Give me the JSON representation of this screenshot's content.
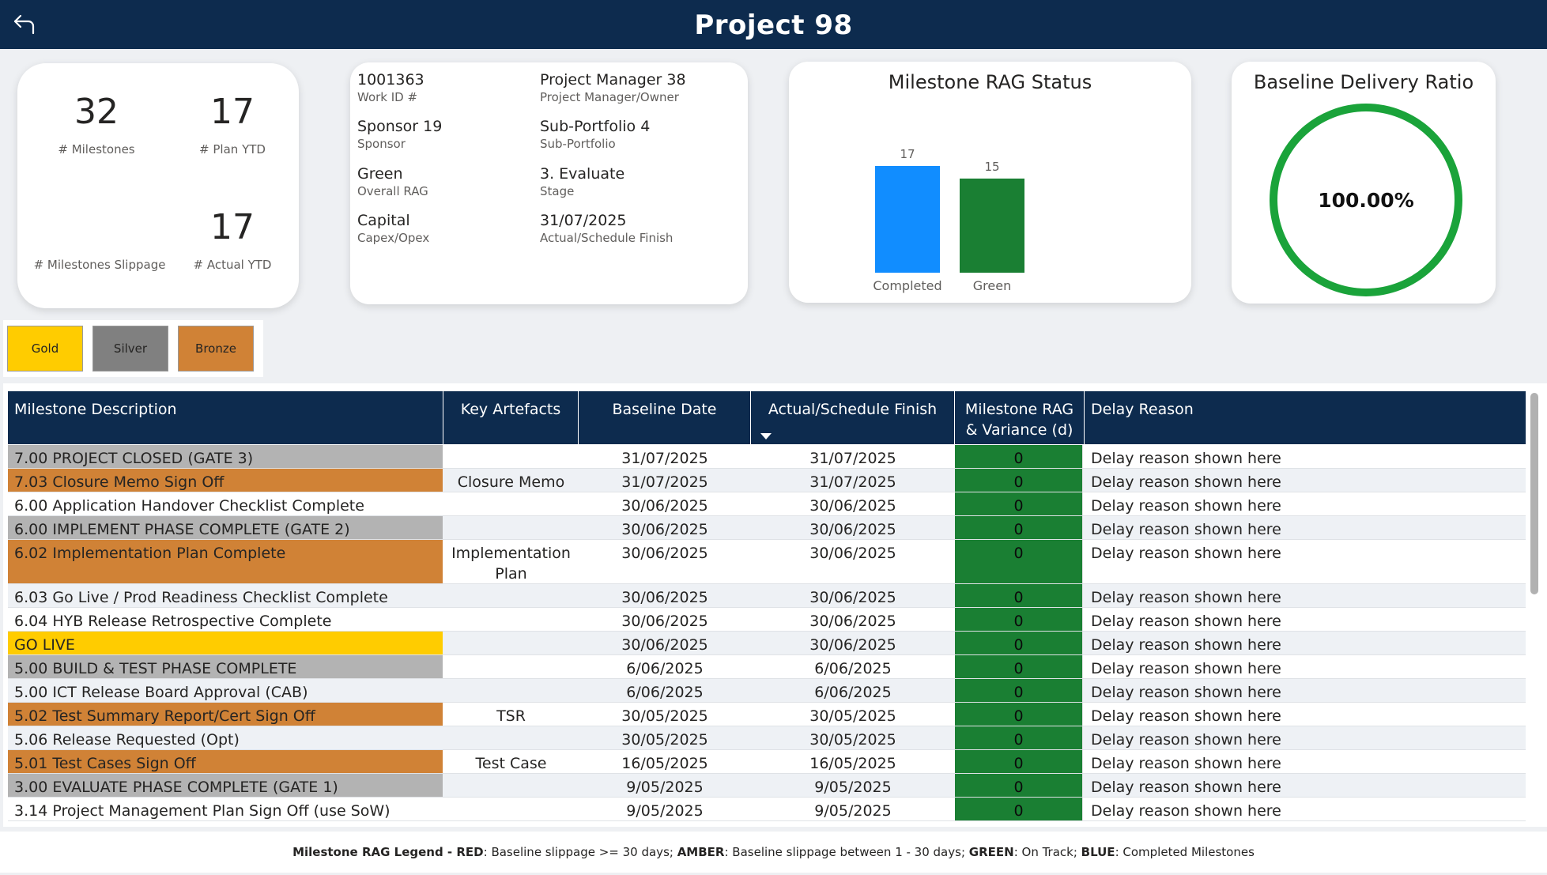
{
  "header": {
    "title": "Project 98",
    "back_icon": "back-arrow-icon"
  },
  "kpis": {
    "milestones": {
      "value": "32",
      "label": "# Milestones"
    },
    "plan_ytd": {
      "value": "17",
      "label": "# Plan YTD"
    },
    "slippage": {
      "value": "",
      "label": "# Milestones Slippage"
    },
    "actual_ytd": {
      "value": "17",
      "label": "# Actual YTD"
    }
  },
  "info": {
    "work_id": {
      "value": "1001363",
      "label": "Work ID #"
    },
    "manager": {
      "value": "Project Manager 38",
      "label": "Project Manager/Owner"
    },
    "sponsor": {
      "value": "Sponsor 19",
      "label": "Sponsor"
    },
    "sub_portfolio": {
      "value": "Sub-Portfolio 4",
      "label": "Sub-Portfolio"
    },
    "rag": {
      "value": "Green",
      "label": "Overall RAG"
    },
    "stage": {
      "value": "3. Evaluate",
      "label": "Stage"
    },
    "capex": {
      "value": "Capital",
      "label": "Capex/Opex"
    },
    "finish": {
      "value": "31/07/2025",
      "label": "Actual/Schedule Finish"
    }
  },
  "chart_data": {
    "type": "bar",
    "title": "Milestone RAG Status",
    "categories": [
      "Completed",
      "Green"
    ],
    "values": [
      17,
      15
    ],
    "colors": [
      "#118dff",
      "#1a7f33"
    ],
    "data_labels": [
      "17",
      "15"
    ],
    "ylim": [
      0,
      17
    ],
    "grid": false
  },
  "ratio": {
    "title": "Baseline Delivery Ratio",
    "value": "100.00%",
    "color": "#1aa33a"
  },
  "tiers": [
    {
      "label": "Gold",
      "color": "#ffcc00"
    },
    {
      "label": "Silver",
      "color": "#808080"
    },
    {
      "label": "Bronze",
      "color": "#d08236"
    }
  ],
  "table": {
    "columns": {
      "desc": "Milestone Description",
      "art": "Key Artefacts",
      "base": "Baseline Date",
      "act": "Actual/Schedule Finish",
      "rag": "Milestone RAG & Variance (d)",
      "delay": "Delay Reason"
    },
    "sort_icon": "sort-descending-icon",
    "highlight_colors": {
      "gold": "#ffcc00",
      "silver": "#b3b3b3",
      "bronze": "#d08236"
    },
    "rows": [
      {
        "desc": "7.00 PROJECT CLOSED (GATE 3)",
        "art": "",
        "base": "31/07/2025",
        "act": "31/07/2025",
        "rag": "0",
        "delay": "Delay reason shown here",
        "tier": "silver"
      },
      {
        "desc": "7.03 Closure Memo Sign Off",
        "art": "Closure Memo",
        "base": "31/07/2025",
        "act": "31/07/2025",
        "rag": "0",
        "delay": "Delay reason shown here",
        "tier": "bronze"
      },
      {
        "desc": "6.00 Application Handover Checklist Complete",
        "art": "",
        "base": "30/06/2025",
        "act": "30/06/2025",
        "rag": "0",
        "delay": "Delay reason shown here",
        "tier": ""
      },
      {
        "desc": "6.00 IMPLEMENT PHASE COMPLETE (GATE 2)",
        "art": "",
        "base": "30/06/2025",
        "act": "30/06/2025",
        "rag": "0",
        "delay": "Delay reason shown here",
        "tier": "silver"
      },
      {
        "desc": "6.02 Implementation Plan Complete",
        "art": "Implementation Plan",
        "base": "30/06/2025",
        "act": "30/06/2025",
        "rag": "0",
        "delay": "Delay reason shown here",
        "tier": "bronze",
        "tall": true
      },
      {
        "desc": "6.03 Go Live / Prod Readiness Checklist Complete",
        "art": "",
        "base": "30/06/2025",
        "act": "30/06/2025",
        "rag": "0",
        "delay": "Delay reason shown here",
        "tier": ""
      },
      {
        "desc": "6.04 HYB Release Retrospective Complete",
        "art": "",
        "base": "30/06/2025",
        "act": "30/06/2025",
        "rag": "0",
        "delay": "Delay reason shown here",
        "tier": ""
      },
      {
        "desc": "GO LIVE",
        "art": "",
        "base": "30/06/2025",
        "act": "30/06/2025",
        "rag": "0",
        "delay": "Delay reason shown here",
        "tier": "gold"
      },
      {
        "desc": "5.00 BUILD & TEST PHASE COMPLETE",
        "art": "",
        "base": "6/06/2025",
        "act": "6/06/2025",
        "rag": "0",
        "delay": "Delay reason shown here",
        "tier": "silver"
      },
      {
        "desc": "5.00 ICT Release Board Approval (CAB)",
        "art": "",
        "base": "6/06/2025",
        "act": "6/06/2025",
        "rag": "0",
        "delay": "Delay reason shown here",
        "tier": ""
      },
      {
        "desc": "5.02 Test Summary Report/Cert Sign Off",
        "art": "TSR",
        "base": "30/05/2025",
        "act": "30/05/2025",
        "rag": "0",
        "delay": "Delay reason shown here",
        "tier": "bronze"
      },
      {
        "desc": "5.06 Release Requested (Opt)",
        "art": "",
        "base": "30/05/2025",
        "act": "30/05/2025",
        "rag": "0",
        "delay": "Delay reason shown here",
        "tier": ""
      },
      {
        "desc": "5.01 Test Cases Sign Off",
        "art": "Test Case",
        "base": "16/05/2025",
        "act": "16/05/2025",
        "rag": "0",
        "delay": "Delay reason shown here",
        "tier": "bronze"
      },
      {
        "desc": "3.00 EVALUATE PHASE COMPLETE (GATE 1)",
        "art": "",
        "base": "9/05/2025",
        "act": "9/05/2025",
        "rag": "0",
        "delay": "Delay reason shown here",
        "tier": "silver"
      },
      {
        "desc": "3.14 Project Management Plan Sign Off (use SoW)",
        "art": "",
        "base": "9/05/2025",
        "act": "9/05/2025",
        "rag": "0",
        "delay": "Delay reason shown here",
        "tier": ""
      }
    ]
  },
  "legend": {
    "title": "Milestone RAG Legend - ",
    "red_key": "RED",
    "red_text": ": Baseline slippage >= 30 days; ",
    "amber_key": "AMBER",
    "amber_text": ": Baseline slippage between 1 - 30 days; ",
    "green_key": "GREEN",
    "green_text": ": On Track; ",
    "blue_key": "BLUE",
    "blue_text": ": Completed Milestones"
  }
}
